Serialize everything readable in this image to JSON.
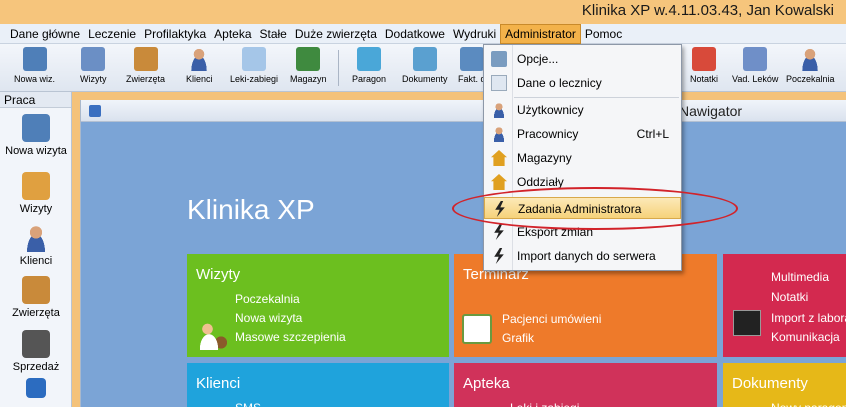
{
  "window": {
    "title": "Klinika XP w.4.11.03.43, Jan Kowalski"
  },
  "menubar": [
    {
      "label": "Dane główne"
    },
    {
      "label": "Leczenie"
    },
    {
      "label": "Profilaktyka"
    },
    {
      "label": "Apteka"
    },
    {
      "label": "Stałe"
    },
    {
      "label": "Duże zwierzęta"
    },
    {
      "label": "Dodatkowe"
    },
    {
      "label": "Wydruki"
    },
    {
      "label": "Administrator"
    },
    {
      "label": "Pomoc"
    }
  ],
  "toolbar": [
    {
      "label": "Nowa wiz.",
      "icon": "new-visit-icon"
    },
    {
      "label": "Wizyty",
      "icon": "visits-icon"
    },
    {
      "label": "Zwierzęta",
      "icon": "animals-icon"
    },
    {
      "label": "Klienci",
      "icon": "clients-icon"
    },
    {
      "label": "Leki-zabiegi",
      "icon": "drugs-icon"
    },
    {
      "label": "Magazyn",
      "icon": "warehouse-icon"
    },
    {
      "label": "Paragon",
      "icon": "receipt-icon"
    },
    {
      "label": "Dokumenty",
      "icon": "documents-icon"
    },
    {
      "label": "Fakt. d",
      "icon": "invoice-icon"
    },
    {
      "label": "Notatki",
      "icon": "notes-icon"
    },
    {
      "label": "Vad. Leków",
      "icon": "drug-book-icon"
    },
    {
      "label": "Poczekalnia",
      "icon": "waiting-room-icon"
    }
  ],
  "sidebar": {
    "header": "Praca",
    "items": [
      {
        "label": "Nowa wizyta",
        "icon": "new-visit-icon"
      },
      {
        "label": "Wizyty",
        "icon": "visits-icon"
      },
      {
        "label": "Klienci",
        "icon": "clients-icon"
      },
      {
        "label": "Zwierzęta",
        "icon": "animals-icon"
      },
      {
        "label": "Sprzedaż",
        "icon": "cash-register-icon"
      }
    ]
  },
  "navigator": {
    "title": "Nawigator",
    "brand": "Klinika XP"
  },
  "tiles": {
    "wizyty": {
      "title": "Wizyty",
      "items": [
        "Poczekalnia",
        "Nowa wizyta",
        "Masowe szczepienia"
      ],
      "color": "#6cbf1f"
    },
    "terminarz": {
      "title": "Terminarz",
      "items": [
        "Pacjenci umówieni",
        "Grafik"
      ],
      "color": "#ee7a2a"
    },
    "misc": {
      "items": [
        "Multimedia",
        "Notatki",
        "Import z labora",
        "Komunikacja"
      ],
      "color": "#d3294f"
    },
    "klienci": {
      "title": "Klienci",
      "items": [
        "SMS"
      ],
      "color": "#1fa3dc"
    },
    "apteka": {
      "title": "Apteka",
      "items": [
        "Leki i zabiegi"
      ],
      "color": "#d0325a"
    },
    "dokumenty": {
      "title": "Dokumenty",
      "items": [
        "Nowy paragon"
      ],
      "color": "#e6b818"
    }
  },
  "admin_menu": [
    {
      "label": "Opcje...",
      "icon": "options-icon"
    },
    {
      "label": "Dane o lecznicy",
      "icon": "clinic-data-icon"
    },
    {
      "label": "Użytkownicy",
      "icon": "users-icon"
    },
    {
      "label": "Pracownicy",
      "icon": "employees-icon",
      "shortcut": "Ctrl+L"
    },
    {
      "label": "Magazyny",
      "icon": "warehouses-icon"
    },
    {
      "label": "Oddziały",
      "icon": "branches-icon"
    },
    {
      "label": "Zadania Administratora",
      "icon": "admin-tasks-icon",
      "highlighted": true
    },
    {
      "label": "Eksport zmian",
      "icon": "export-icon"
    },
    {
      "label": "Import danych do serwera",
      "icon": "import-icon"
    }
  ]
}
